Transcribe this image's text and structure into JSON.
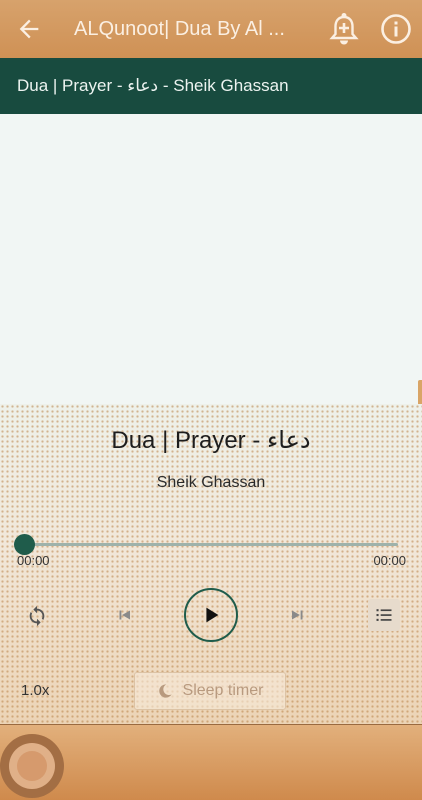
{
  "app_bar": {
    "title": "ALQunoot| Dua By Al ...",
    "icons": [
      "back-arrow-icon",
      "add-alarm-bell-icon",
      "info-icon"
    ]
  },
  "subheader": {
    "text": "Dua | Prayer - دعاء - Sheik Ghassan"
  },
  "player": {
    "title": "Dua | Prayer - دعاء",
    "artist": "Sheik Ghassan",
    "current_time": "00:00",
    "duration": "00:00",
    "progress": 0,
    "speed": "1.0x",
    "sleep_timer_label": "Sleep timer",
    "controls": [
      "repeat-icon",
      "previous-icon",
      "play-icon",
      "next-icon",
      "playlist-icon"
    ]
  },
  "colors": {
    "app_bar": "#cf9155",
    "subheader": "#184b3f",
    "accent": "#1f5c4b"
  }
}
